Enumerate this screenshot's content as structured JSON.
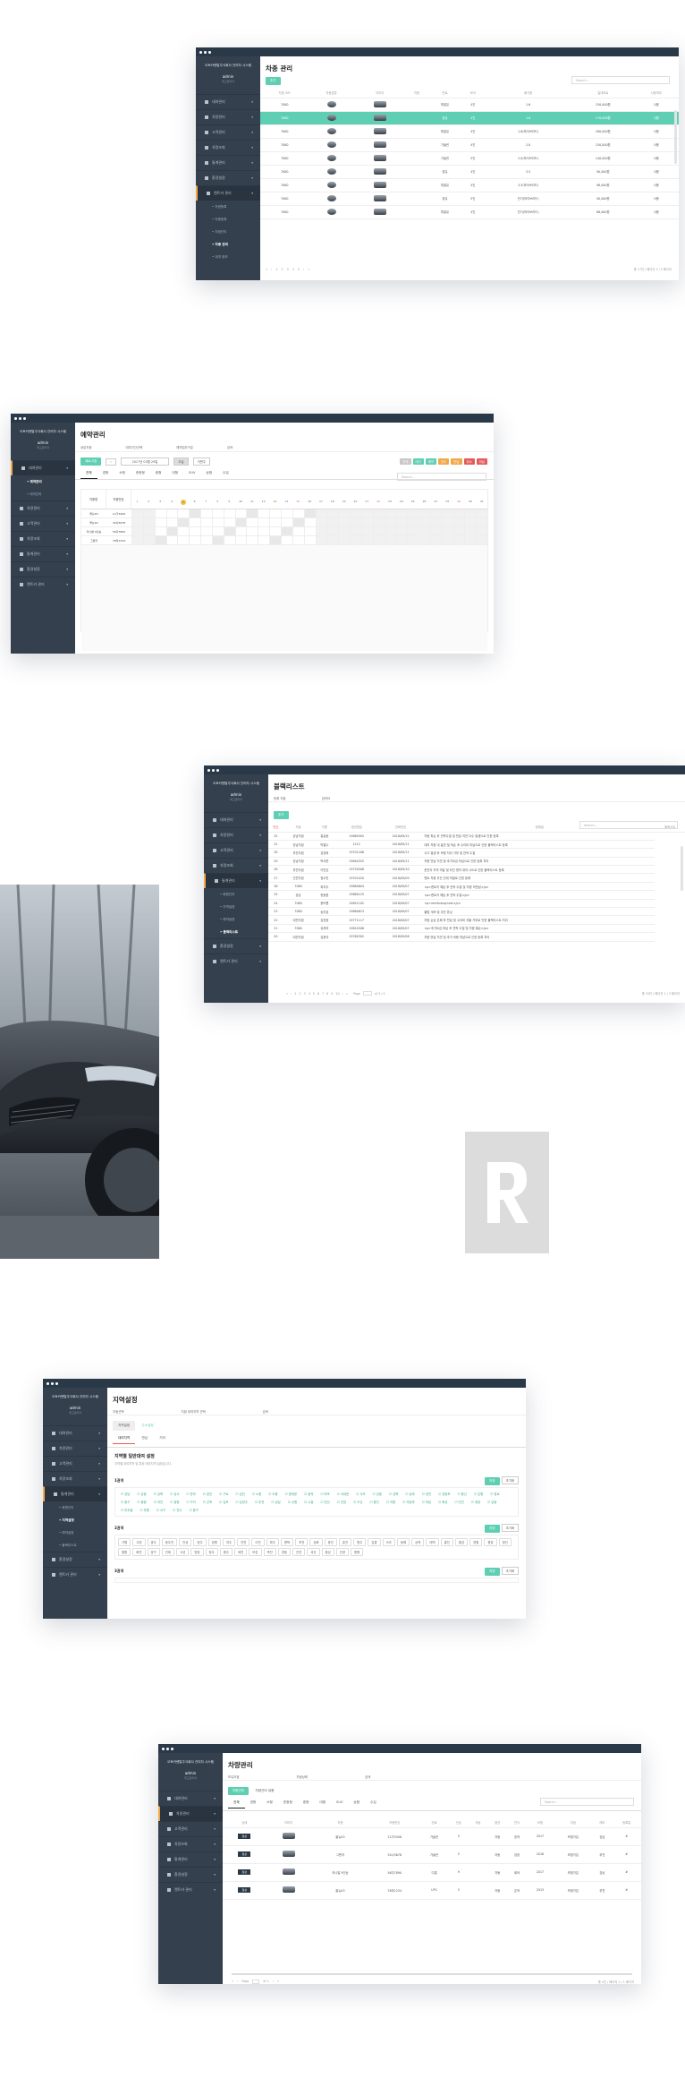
{
  "shared": {
    "company": "오토카렌탈주식회사 관리자 시스템",
    "admin": "admin",
    "admin_role": "최고관리자",
    "search_placeholder": "Search..."
  },
  "s1": {
    "title": "차종 관리",
    "add": "추가",
    "menu": [
      "대여관리",
      "차량관리",
      "고객관리",
      "차량조회",
      "통계관리",
      "환경설정",
      "렌트카 관리"
    ],
    "sub": [
      "차량등록",
      "차종등록",
      "지점관리",
      "차종 관리",
      "대여 정보"
    ],
    "cols": [
      "차종 코드",
      "차종분류",
      "이미지",
      "차종",
      "연료",
      "좌석",
      "배기량",
      "일대여료",
      "사용여부"
    ],
    "rows": [
      [
        "7080",
        "",
        "",
        "",
        "휘발유",
        "4인",
        "1.6",
        "150,000원",
        "사용"
      ],
      [
        "7080",
        "",
        "",
        "",
        "경유",
        "4인",
        "1.6",
        "170,000원",
        "사용"
      ],
      [
        "7080",
        "",
        "",
        "",
        "휘발유",
        "4인",
        "1.6(하이브리드)",
        "180,000원",
        "사용"
      ],
      [
        "7080",
        "",
        "",
        "",
        "가솔린",
        "4인",
        "2.0",
        "150,000원",
        "사용"
      ],
      [
        "7080",
        "",
        "",
        "",
        "가솔린",
        "5인",
        "2.0(하이브리드)",
        "140,000원",
        "사용"
      ],
      [
        "7080",
        "",
        "",
        "",
        "경유",
        "4인",
        "3.5",
        "90,000원",
        "사용"
      ],
      [
        "7080",
        "",
        "",
        "",
        "휘발유",
        "4인",
        "3.5(하이브리드)",
        "98,000원",
        "사용"
      ],
      [
        "7080",
        "",
        "",
        "",
        "경유",
        "5인",
        "전기(하이브리드)",
        "90,000원",
        "사용"
      ],
      [
        "7080",
        "",
        "",
        "",
        "휘발유",
        "4인",
        "전기(하이브리드)",
        "88,000원",
        "사용"
      ]
    ],
    "pages": [
      "«",
      "‹",
      "1",
      "2",
      "3",
      "4",
      "5",
      "›",
      "»"
    ],
    "total": "총 17건 / 페이지 1 / 2 페이지"
  },
  "s2": {
    "title": "예약관리",
    "f1": "상담지점",
    "f2": "대여기간선택",
    "f3": "예약업무구분",
    "f4": "검색",
    "date": "2017년 03월 29일",
    "btns": [
      "새로고침",
      "오늘",
      "이번주"
    ],
    "legend": [
      "전체",
      "대기",
      "예약",
      "인도",
      "반납",
      "취소",
      "미납"
    ],
    "tabs": [
      "전체",
      "경형",
      "소형",
      "준중형",
      "중형",
      "대형",
      "SUV",
      "승합",
      "수입"
    ],
    "days": [
      "1",
      "2",
      "3",
      "4",
      "5",
      "6",
      "7",
      "8",
      "9",
      "10",
      "11",
      "12",
      "13",
      "14",
      "15",
      "16",
      "17",
      "18",
      "19",
      "20",
      "21",
      "22",
      "23",
      "24",
      "25",
      "26",
      "27",
      "28",
      "29",
      "30",
      "31"
    ],
    "rows": [
      {
        "m": "올뉴K3",
        "p": "12가3456"
      },
      {
        "m": "올뉴K3",
        "p": "34나5678"
      },
      {
        "m": "카니발 9인승",
        "p": "56다7890"
      },
      {
        "m": "그랜저",
        "p": "78라1234"
      }
    ],
    "h1": "차종명",
    "h2": "차량번호"
  },
  "s3": {
    "title": "블랙리스트",
    "f1": "등록 지점",
    "f2": "검색어",
    "add": "추가",
    "cols": [
      "번호",
      "지점",
      "이름",
      "생년월일",
      "전화번호",
      "등록일",
      "블랙사유"
    ],
    "rows": [
      [
        "32",
        "강남지점",
        "홍길동",
        "19880505",
        "2018/09/12",
        "차량 파손 후 연락두절 및 반납 지연 다수 발생으로 인한 등록"
      ],
      [
        "31",
        "강남지점",
        "박철수",
        "1212",
        "2018/09/11",
        "대여 차량 내 흡연 및 파손 후 수리비 미납으로 인한 블랙리스트 등록"
      ],
      [
        "30",
        "부천지점",
        "김영희",
        "19701206",
        "2018/09/11",
        "사고 발생 후 보험 처리 거부 및 연락 두절"
      ],
      [
        "29",
        "강남지점",
        "박서준",
        "19840325",
        "2018/09/11",
        "차량 반납 지연 및 추가요금 미납으로 인한 등록 처리"
      ],
      [
        "28",
        "부천지점",
        "이민호",
        "19750508",
        "2018/09/10",
        "운전자 자격 미달 및 타인 명의 대여 시도로 인한 블랙리스트 등록"
      ],
      [
        "27",
        "인천지점",
        "정수민",
        "19701020",
        "2018/09/09",
        "렌트 차량 무단 전대 적발로 인한 등록"
      ],
      [
        "26",
        "7080",
        "최지우",
        "19880604",
        "2018/09/07",
        "<p>렌트카 예납 후 연락 두절 및 차량 미반납</p>"
      ],
      [
        "25",
        "강남",
        "한동훈",
        "19860125",
        "2018/09/07",
        "<p>렌트카 예납 후 연락 두절</p>"
      ],
      [
        "24",
        "7080",
        "윤아름",
        "19851102",
        "2018/09/07",
        "<p>rent&nbsp;test</p>"
      ],
      [
        "23",
        "7080",
        "송지효",
        "19880613",
        "2018/09/07",
        "불법 개조 및 무단 튜닝"
      ],
      [
        "22",
        "대전지점",
        "강호동",
        "19771117",
        "2018/09/07",
        "차량 손상 은폐 후 반납 및 수리비 지불 거부로 인한 블랙리스트 처리"
      ],
      [
        "21",
        "7080",
        "유재석",
        "19810506",
        "2018/09/07",
        "<p>추가요금 미납 후 연락 두절 및 차량 훼손</p>"
      ],
      [
        "20",
        "대전지점",
        "김종국",
        "19760302",
        "2018/09/06",
        "차량 반납 지연 및 추가 비용 미납으로 인한 등록 처리"
      ]
    ],
    "pages": [
      "«",
      "‹",
      "1",
      "2",
      "3",
      "4",
      "5",
      "6",
      "7",
      "8",
      "9",
      "10",
      "›",
      "»"
    ],
    "page_label": "Page",
    "page_of": "of 3 / 4",
    "total": "총 33건 / 페이지 1 / 3 페이지"
  },
  "s4": {
    "title": "지역설정",
    "f1": "지점선택",
    "f2": "지점 대여지역 선택",
    "f3": "검색",
    "tabs": [
      "지역설정",
      "주소설정"
    ],
    "subtabs": [
      "대여지역",
      "반납",
      "기타"
    ],
    "heading": "지역별 일반대여 설정",
    "desc": "지역별 대여지역 및 특정 대여지역 설정입니다.",
    "groups": [
      {
        "label": "1권역",
        "items": [
          "강남",
          "강동",
          "강북",
          "강서",
          "관악",
          "광진",
          "구로",
          "금천",
          "노원",
          "도봉",
          "동대문",
          "동작",
          "마포",
          "서대문",
          "서초",
          "성동",
          "성북",
          "송파",
          "양천",
          "영등포",
          "용산",
          "은평",
          "종로",
          "중구",
          "중랑",
          "과천",
          "광명",
          "구리",
          "군포",
          "김포",
          "남양주",
          "부천",
          "성남",
          "수원",
          "시흥",
          "안산",
          "안양",
          "오산",
          "용인",
          "의왕",
          "의정부",
          "하남",
          "화성",
          "인천",
          "계양",
          "남동",
          "미추홀",
          "부평",
          "서구",
          "연수",
          "중구"
        ],
        "g": true
      },
      {
        "label": "2권역",
        "items": [
          "가평",
          "고양",
          "광주",
          "동두천",
          "안성",
          "양주",
          "양평",
          "여주",
          "연천",
          "이천",
          "파주",
          "평택",
          "포천",
          "강화",
          "옹진",
          "춘천",
          "원주",
          "강릉",
          "속초",
          "동해",
          "삼척",
          "태백",
          "홍천",
          "횡성",
          "영월",
          "평창",
          "정선",
          "철원",
          "화천",
          "양구",
          "인제",
          "고성",
          "양양",
          "청주",
          "충주",
          "제천",
          "보은",
          "옥천",
          "영동",
          "진천",
          "괴산",
          "음성",
          "단양",
          "증평"
        ],
        "g": false
      },
      {
        "label": "3권역",
        "items": [],
        "g": false
      }
    ],
    "save": "저장",
    "reset": "초기화"
  },
  "s5": {
    "title": "차량관리",
    "f1": "보유지점",
    "f2": "차량상태",
    "f3": "검색",
    "tab": "차량관리",
    "tab2": "차량관리 내용",
    "tabs": [
      "전체",
      "경형",
      "소형",
      "준중형",
      "중형",
      "대형",
      "SUV",
      "승합",
      "수입"
    ],
    "cols": [
      "상태",
      "이미지",
      "차종",
      "차량번호",
      "연료",
      "인승",
      "색상",
      "옵션",
      "연식",
      "보험",
      "지점",
      "메모",
      "등록일"
    ],
    "rows": [
      [
        "정상",
        "",
        "올뉴K3",
        "12가3456",
        "가솔린",
        "5",
        "",
        "자동",
        "흰색",
        "2017",
        "보험가입",
        "강남",
        "#"
      ],
      [
        "정상",
        "",
        "그랜저",
        "34나5678",
        "가솔린",
        "5",
        "",
        "자동",
        "검정",
        "2016",
        "보험가입",
        "부천",
        "#"
      ],
      [
        "정상",
        "",
        "카니발 9인승",
        "56다7890",
        "디젤",
        "9",
        "",
        "자동",
        "회색",
        "2017",
        "보험가입",
        "강남",
        "#"
      ],
      [
        "정상",
        "",
        "올뉴K3",
        "78라1234",
        "LPG",
        "5",
        "",
        "자동",
        "은색",
        "2015",
        "보험가입",
        "부천",
        "#"
      ]
    ],
    "page_label": "Page",
    "page_of": "of 1",
    "total": "총 4건 / 페이지 1 / 1 페이지"
  },
  "colors": {
    "accent": "#5fcfb3",
    "sidebar": "#34404e",
    "titlebar": "#2a3948",
    "active": "#f0a84a"
  }
}
